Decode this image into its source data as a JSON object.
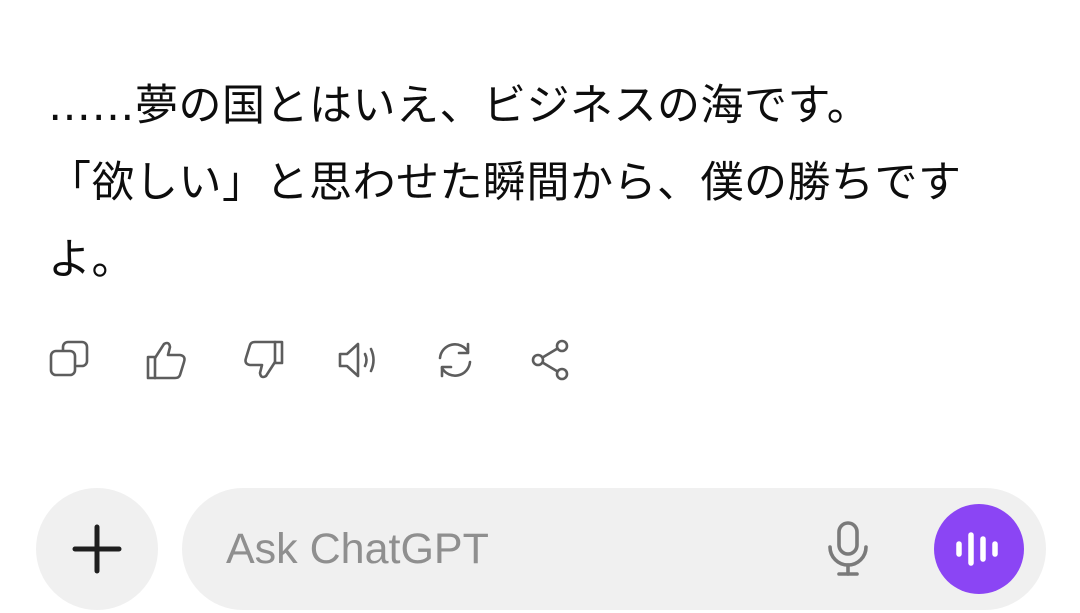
{
  "message": {
    "lines": [
      "……夢の国とはいえ、ビジネスの海です。",
      "「欲しい」と思わせた瞬間から、僕の勝ちです",
      "よ。"
    ]
  },
  "actions": {
    "copy": "copy-icon",
    "thumbs_up": "thumbs-up-icon",
    "thumbs_down": "thumbs-down-icon",
    "read_aloud": "speaker-icon",
    "regenerate": "refresh-icon",
    "share": "share-icon"
  },
  "composer": {
    "placeholder": "Ask ChatGPT",
    "value": "",
    "plus_icon": "plus-icon",
    "mic_icon": "microphone-icon",
    "voice_icon": "voice-waveform-icon"
  },
  "colors": {
    "voice_button": "#8b45f4",
    "input_background": "#f0f0f0",
    "icon": "#5d5d5d"
  }
}
